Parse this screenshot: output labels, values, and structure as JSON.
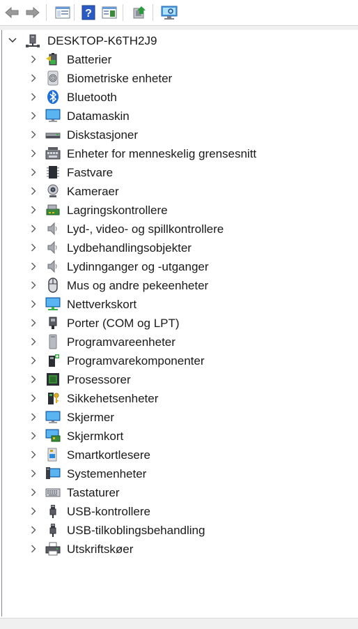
{
  "toolbar": {
    "buttons": [
      {
        "name": "back-arrow-icon"
      },
      {
        "name": "forward-arrow-icon"
      },
      {
        "name": "properties-icon"
      },
      {
        "name": "help-icon"
      },
      {
        "name": "show-hide-console-tree-icon"
      },
      {
        "name": "update-driver-icon"
      },
      {
        "name": "scan-hardware-icon"
      }
    ]
  },
  "tree": {
    "root": {
      "label": "DESKTOP-K6TH2J9",
      "icon": "computer-network-icon",
      "expanded": true
    },
    "items": [
      {
        "label": "Batterier",
        "icon": "battery-icon"
      },
      {
        "label": "Biometriske enheter",
        "icon": "fingerprint-icon"
      },
      {
        "label": "Bluetooth",
        "icon": "bluetooth-icon"
      },
      {
        "label": "Datamaskin",
        "icon": "monitor-icon"
      },
      {
        "label": "Diskstasjoner",
        "icon": "disk-drive-icon"
      },
      {
        "label": "Enheter for menneskelig grensesnitt",
        "icon": "hid-keyboard-icon"
      },
      {
        "label": "Fastvare",
        "icon": "firmware-chip-icon"
      },
      {
        "label": "Kameraer",
        "icon": "webcam-icon"
      },
      {
        "label": "Lagringskontrollere",
        "icon": "storage-controller-icon"
      },
      {
        "label": "Lyd-, video- og spillkontrollere",
        "icon": "speaker-icon"
      },
      {
        "label": "Lydbehandlingsobjekter",
        "icon": "speaker-icon"
      },
      {
        "label": "Lydinnganger og -utganger",
        "icon": "speaker-icon"
      },
      {
        "label": "Mus og andre pekeenheter",
        "icon": "mouse-icon"
      },
      {
        "label": "Nettverkskort",
        "icon": "network-adapter-icon"
      },
      {
        "label": "Porter (COM og LPT)",
        "icon": "port-connector-icon"
      },
      {
        "label": "Programvareenheter",
        "icon": "software-device-icon"
      },
      {
        "label": "Programvarekomponenter",
        "icon": "software-component-icon"
      },
      {
        "label": "Prosessorer",
        "icon": "processor-icon"
      },
      {
        "label": "Sikkehetsenheter",
        "icon": "security-key-icon"
      },
      {
        "label": "Skjermer",
        "icon": "display-icon"
      },
      {
        "label": "Skjermkort",
        "icon": "display-adapter-icon"
      },
      {
        "label": "Smartkortlesere",
        "icon": "smart-card-reader-icon"
      },
      {
        "label": "Systemenheter",
        "icon": "system-devices-icon"
      },
      {
        "label": "Tastaturer",
        "icon": "keyboard-icon"
      },
      {
        "label": "USB-kontrollere",
        "icon": "usb-plug-icon"
      },
      {
        "label": "USB-tilkoblingsbehandling",
        "icon": "usb-plug-icon"
      },
      {
        "label": "Utskriftskøer",
        "icon": "printer-icon"
      }
    ]
  },
  "colors": {
    "blue": "#1e73d6",
    "chevron": "#6a6a6a"
  }
}
